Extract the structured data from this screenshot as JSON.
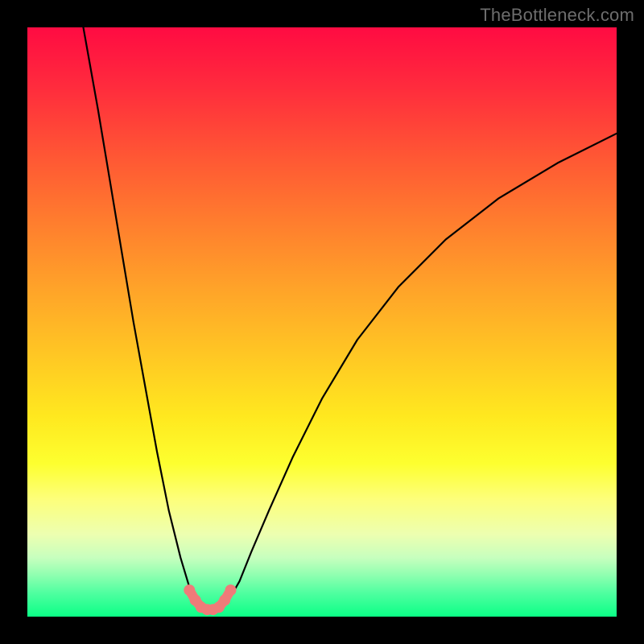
{
  "watermark": "TheBottleneck.com",
  "chart_data": {
    "type": "line",
    "title": "",
    "xlabel": "",
    "ylabel": "",
    "xlim": [
      0,
      100
    ],
    "ylim": [
      0,
      100
    ],
    "grid": false,
    "legend": false,
    "series": [
      {
        "name": "left-branch",
        "color": "#000000",
        "x": [
          9.5,
          12,
          14,
          16,
          18,
          20,
          22,
          24,
          26,
          27.5,
          28.5
        ],
        "y": [
          100,
          86,
          74,
          62,
          50,
          39,
          28,
          18,
          10,
          5,
          2.5
        ]
      },
      {
        "name": "right-branch",
        "color": "#000000",
        "x": [
          34,
          36,
          38,
          41,
          45,
          50,
          56,
          63,
          71,
          80,
          90,
          100
        ],
        "y": [
          2.5,
          6,
          11,
          18,
          27,
          37,
          47,
          56,
          64,
          71,
          77,
          82
        ]
      },
      {
        "name": "trough-highlight",
        "color": "#ef7b79",
        "x": [
          27.5,
          28.5,
          29.5,
          30.5,
          31.5,
          32.5,
          33.5,
          34.5
        ],
        "y": [
          4.5,
          2.8,
          1.6,
          1.2,
          1.2,
          1.6,
          2.8,
          4.5
        ]
      }
    ],
    "background_gradient": {
      "direction": "top-to-bottom",
      "stops": [
        {
          "pos": 0.0,
          "color": "#ff0b42"
        },
        {
          "pos": 0.33,
          "color": "#ff7d2e"
        },
        {
          "pos": 0.66,
          "color": "#ffe81f"
        },
        {
          "pos": 0.8,
          "color": "#fdff7a"
        },
        {
          "pos": 1.0,
          "color": "#0bff86"
        }
      ]
    }
  }
}
